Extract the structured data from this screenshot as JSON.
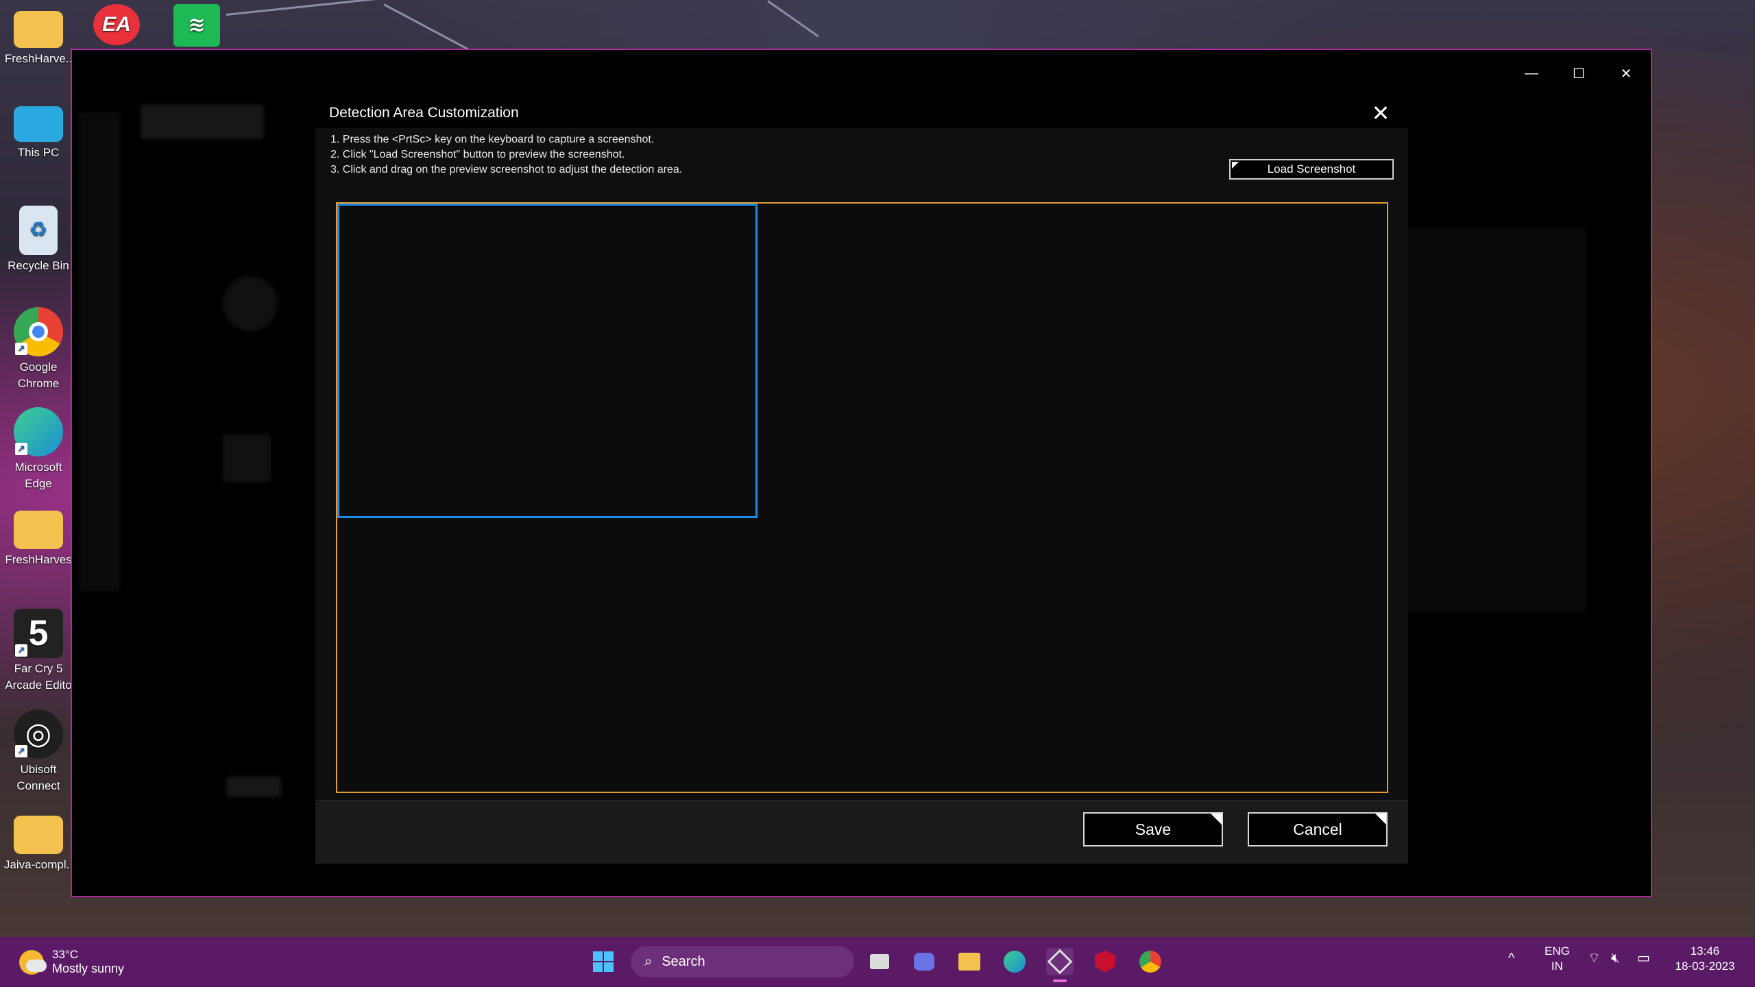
{
  "desktop": {
    "icons": [
      {
        "label": "FreshHarve..",
        "icon": "folder-icon",
        "color": "#f2c14e"
      },
      {
        "label": "This PC",
        "icon": "monitor-icon",
        "color": "#2aa9e0"
      },
      {
        "label": "Recycle Bin",
        "icon": "recycle-bin-icon",
        "color": "#d9e6f2"
      },
      {
        "label": "Google Chrome",
        "icon": "chrome-icon",
        "color": "#e94235"
      },
      {
        "label": "Microsoft Edge",
        "icon": "edge-icon",
        "color": "#1c8fd6"
      },
      {
        "label": "FreshHarves",
        "icon": "folder-icon",
        "color": "#f2c14e"
      },
      {
        "label": "Far Cry 5 Arcade Edito",
        "icon": "farcry-icon",
        "color": "#222222"
      },
      {
        "label": "Ubisoft Connect",
        "icon": "ubisoft-icon",
        "color": "#1f1f1f"
      },
      {
        "label": "Jaiva-compl..",
        "icon": "folder-icon",
        "color": "#f2c14e"
      }
    ],
    "top_icons": [
      {
        "icon": "ea-icon",
        "label": "EA",
        "color": "#e8313a"
      },
      {
        "icon": "spotify-icon",
        "label": "",
        "color": "#1db954"
      }
    ]
  },
  "window": {
    "minimize": "—",
    "maximize": "☐",
    "close": "✕"
  },
  "dialog": {
    "title": "Detection Area Customization",
    "close": "✕",
    "instructions": [
      "1. Press the <PrtSc> key on the keyboard to capture a screenshot.",
      "2. Click \"Load Screenshot\" button to preview the screenshot.",
      "3. Click and drag on the preview screenshot to adjust the detection area."
    ],
    "load_button": "Load Screenshot",
    "save_button": "Save",
    "cancel_button": "Cancel",
    "colors": {
      "preview_border": "#e39a2e",
      "detection_border": "#1e8ce8"
    }
  },
  "taskbar": {
    "weather_temp": "33°C",
    "weather_desc": "Mostly sunny",
    "search_label": "Search",
    "language_top": "ENG",
    "language_bottom": "IN",
    "time": "13:46",
    "date": "18-03-2023",
    "tray_chevron": "^",
    "pinned": [
      "windows-start-icon",
      "task-view-icon",
      "teams-chat-icon",
      "file-explorer-icon",
      "edge-icon",
      "armoury-crate-icon",
      "mcafee-icon",
      "chrome-icon"
    ]
  }
}
